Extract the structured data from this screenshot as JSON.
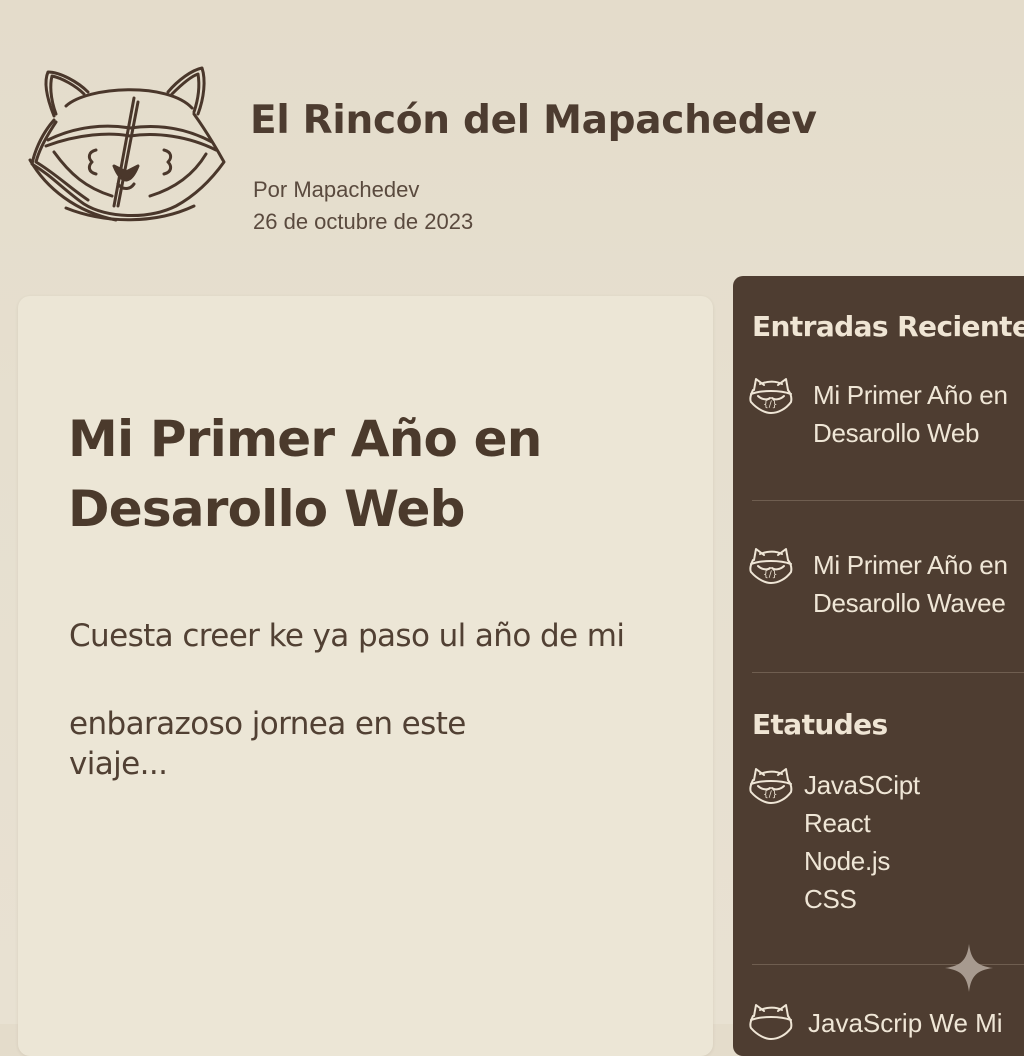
{
  "header": {
    "site_title": "El Rincón del Mapachedev",
    "author": "Por Mapachedev",
    "date": "26 de octubre de 2023",
    "logo_glyph": "{/}"
  },
  "post": {
    "title": "Mi Primer Año en Desarollo Web",
    "paragraph1": "Cuesta creer ke ya paso ul año de mi",
    "paragraph2": "enbarazoso jornea  en este viaje..."
  },
  "sidebar": {
    "recent_heading": "Entradas Recientes",
    "recent_entries": [
      {
        "line1": "Mi Primer Año en",
        "line2": "Desarollo Web"
      },
      {
        "line1": "Mi Primer Año en",
        "line2": "Desarollo Wavee"
      }
    ],
    "studies_heading": "Etatudes",
    "studies": [
      "JavaSCipt",
      "React",
      "Node.js",
      "CSS"
    ],
    "bottom_entry": "JavaScrip We Mi"
  },
  "colors": {
    "background": "#e6dfcf",
    "card": "#ece6d6",
    "sidebar": "#4e3d31",
    "text_dark": "#4b3a2c",
    "text_light": "#efe6d6"
  },
  "icons": {
    "logo": "raccoon-logo-icon",
    "entry": "raccoon-mini-icon",
    "decoration": "sparkle-icon"
  }
}
